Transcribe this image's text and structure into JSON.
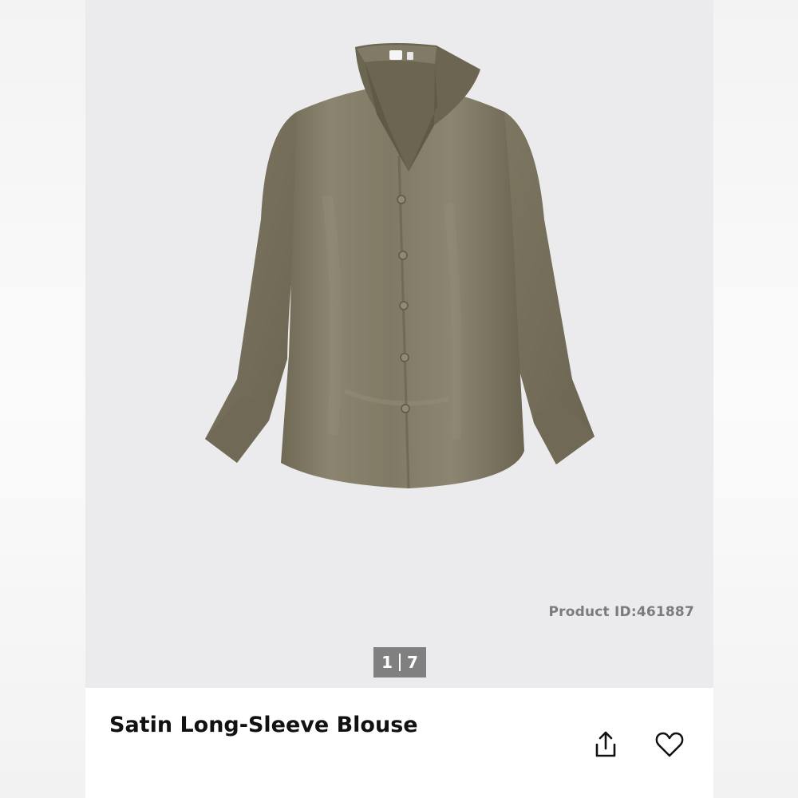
{
  "product": {
    "id_text": "Product ID:461887",
    "title": "Satin Long-Sleeve Blouse",
    "color": "#7b7460"
  },
  "gallery": {
    "current": "1",
    "total": "7"
  },
  "actions": {
    "share_icon": "share-icon",
    "favorite_icon": "heart-icon"
  },
  "colors": {
    "hero_background": "#ebebed",
    "pager_background": "#808080",
    "text_dark": "#111111"
  }
}
